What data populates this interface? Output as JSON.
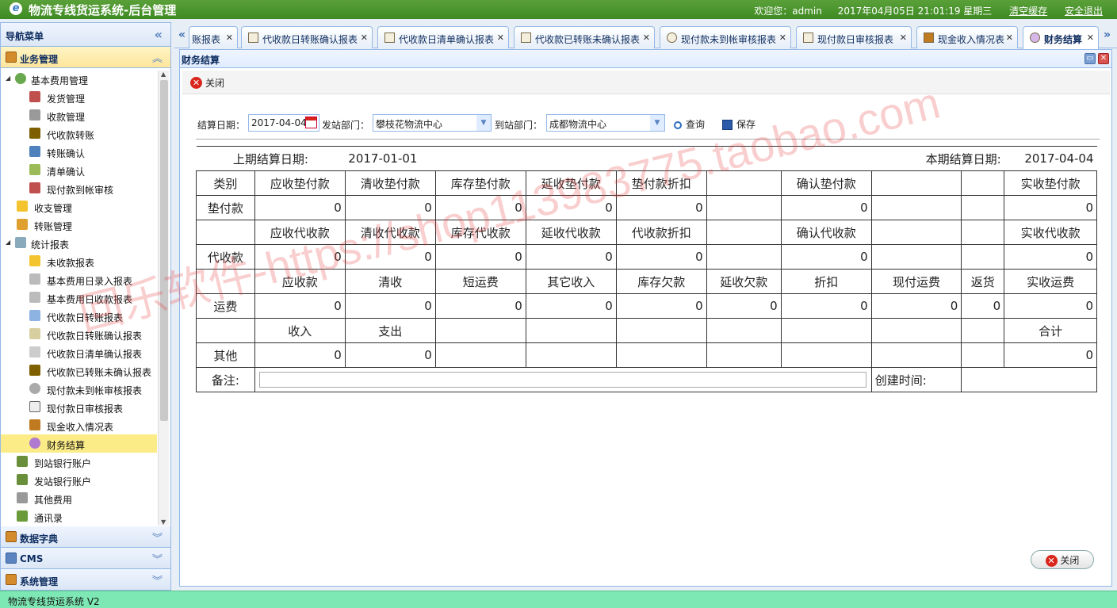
{
  "header": {
    "title": "物流专线货运系统-后台管理",
    "welcome": "欢迎您：admin",
    "datetime": "2017年04月05日 21:01:19 星期三",
    "clear_cache": "清空缓存",
    "logout": "安全退出"
  },
  "sidebar": {
    "title": "导航菜单",
    "sections": {
      "business": "业务管理",
      "dict": "数据字典",
      "cms": "CMS",
      "system": "系统管理"
    },
    "items": [
      "基本费用管理",
      "发货管理",
      "收款管理",
      "代收款转账",
      "转账确认",
      "清单确认",
      "现付款到帐审核",
      "收支管理",
      "转账管理",
      "统计报表",
      "未收款报表",
      "基本费用日录入报表",
      "基本费用日收款报表",
      "代收款日转账报表",
      "代收款日转账确认报表",
      "代收款日清单确认报表",
      "代收款已转账未确认报表",
      "现付款未到帐审核报表",
      "现付款日审核报表",
      "现金收入情况表",
      "财务结算",
      "到站银行账户",
      "发站银行账户",
      "其他费用",
      "通讯录"
    ]
  },
  "tabs": [
    "账报表",
    "代收款日转账确认报表",
    "代收款日清单确认报表",
    "代收款已转账未确认报表",
    "现付款未到帐审核报表",
    "现付款日审核报表",
    "现金收入情况表",
    "财务结算"
  ],
  "panel": {
    "title": "财务结算",
    "close_label": "关闭"
  },
  "filters": {
    "settle_date_label": "结算日期：",
    "settle_date": "2017-04-04",
    "from_dept_label": "发站部门：",
    "from_dept": "攀枝花物流中心",
    "to_dept_label": "到站部门：",
    "to_dept": "成都物流中心",
    "query": "查询",
    "save": "保存"
  },
  "settlement": {
    "prev_date_label": "上期结算日期:",
    "prev_date": "2017-01-01",
    "cur_date_label": "本期结算日期:",
    "cur_date": "2017-04-04",
    "category": "类别",
    "advance": {
      "row_label": "垫付款",
      "h1": "应收垫付款",
      "h2": "清收垫付款",
      "h3": "库存垫付款",
      "h4": "延收垫付款",
      "h5": "垫付款折扣",
      "h7": "确认垫付款",
      "h10": "实收垫付款",
      "v1": "0",
      "v2": "0",
      "v3": "0",
      "v4": "0",
      "v5": "0",
      "v7": "0",
      "v10": "0"
    },
    "collect": {
      "row_label": "代收款",
      "h1": "应收代收款",
      "h2": "清收代收款",
      "h3": "库存代收款",
      "h4": "延收代收款",
      "h5": "代收款折扣",
      "h7": "确认代收款",
      "h10": "实收代收款",
      "v1": "0",
      "v2": "0",
      "v3": "0",
      "v4": "0",
      "v5": "0",
      "v7": "0",
      "v10": "0"
    },
    "freight": {
      "row_label": "运费",
      "h1": "应收款",
      "h2": "清收",
      "h3": "短运费",
      "h4": "其它收入",
      "h5": "库存欠款",
      "h6": "延收欠款",
      "h7": "折扣",
      "h8": "现付运费",
      "h9": "返货",
      "h10": "实收运费",
      "v1": "0",
      "v2": "0",
      "v3": "0",
      "v4": "0",
      "v5": "0",
      "v6": "0",
      "v7": "0",
      "v8": "0",
      "v9": "0",
      "v10": "0"
    },
    "other": {
      "row_label": "其他",
      "h1": "收入",
      "h2": "支出",
      "h10": "合计",
      "v1": "0",
      "v2": "0",
      "v10": "0"
    },
    "memo_label": "备注:",
    "created_label": "创建时间:"
  },
  "footer": {
    "version": "物流专线货运系统 V2"
  },
  "watermark": "回乐软件-https://shop113983775.taobao.com",
  "colors": {
    "header_green": "#4a962c",
    "selected_item": "#fbec88",
    "border_blue": "#95b8e7"
  }
}
